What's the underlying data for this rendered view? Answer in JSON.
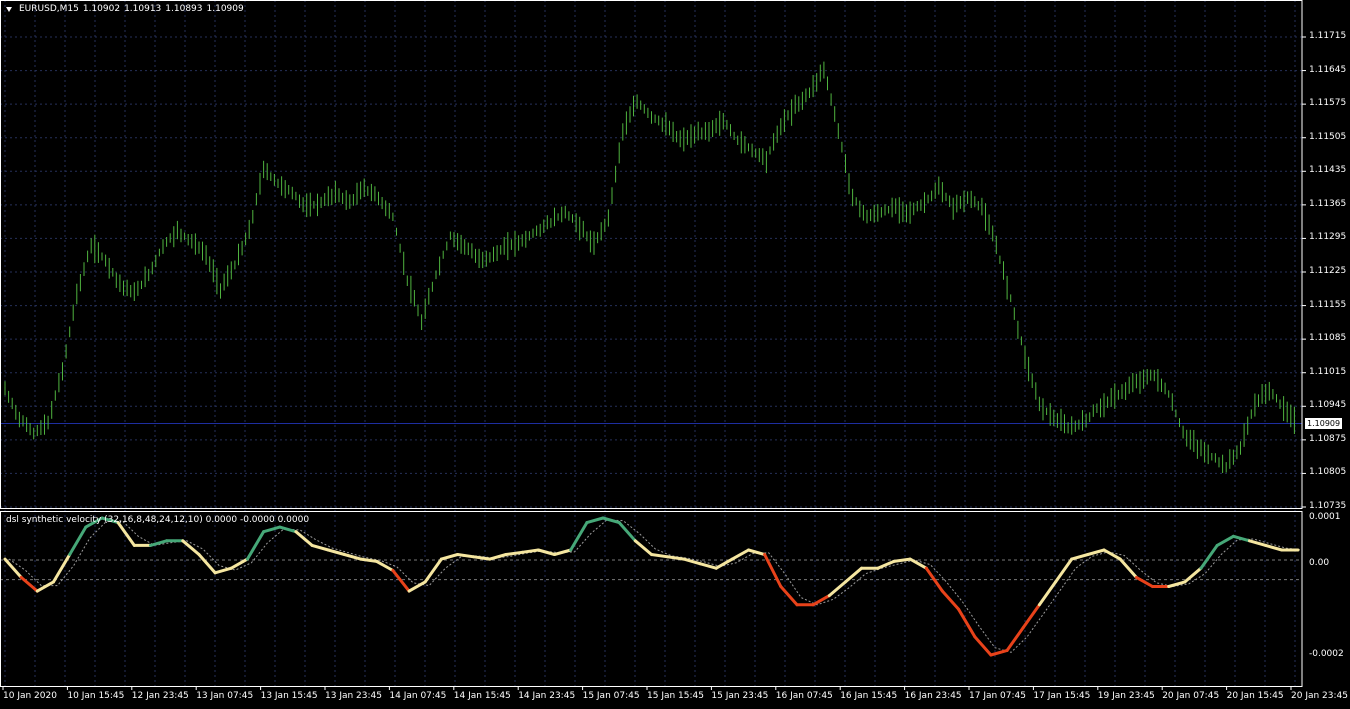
{
  "chart": {
    "symbol_timeframe": "EURUSD,M15",
    "ohlc": [
      "1.10902",
      "1.10913",
      "1.10893",
      "1.10909"
    ],
    "current_price": "1.10909",
    "price_axis": [
      "1.11715",
      "1.11645",
      "1.11575",
      "1.11505",
      "1.11435",
      "1.11365",
      "1.11295",
      "1.11225",
      "1.11155",
      "1.11085",
      "1.11015",
      "1.10945",
      "1.10875",
      "1.10805",
      "1.10735"
    ],
    "indicator_label": "dsl synthetic velocity (32,16,8,48,24,12,10) 0.0000 -0.0000 0.0000",
    "indicator_axis": [
      "0.0001",
      "0.00",
      "-0.0002"
    ],
    "time_axis": [
      "10 Jan 2020",
      "10 Jan 15:45",
      "12 Jan 23:45",
      "13 Jan 07:45",
      "13 Jan 15:45",
      "13 Jan 23:45",
      "14 Jan 07:45",
      "14 Jan 15:45",
      "14 Jan 23:45",
      "15 Jan 07:45",
      "15 Jan 15:45",
      "15 Jan 23:45",
      "16 Jan 07:45",
      "16 Jan 15:45",
      "16 Jan 23:45",
      "17 Jan 07:45",
      "17 Jan 15:45",
      "19 Jan 23:45",
      "20 Jan 07:45",
      "20 Jan 15:45",
      "20 Jan 23:45"
    ],
    "colors": {
      "background": "#000000",
      "grid": "#26305a",
      "bars": "#4fb33f",
      "current_price_line": "#1e2ea0",
      "axis": "#ffffff",
      "velocity_up": "#46a878",
      "velocity_neutral": "#f5e6a0",
      "velocity_down": "#e8421a",
      "levels": "#7a7a7a"
    }
  },
  "chart_data": {
    "type": "line",
    "series": [
      {
        "values": [
          1.1098,
          1.1092,
          1.1089,
          1.1091,
          1.1102,
          1.1118,
          1.1128,
          1.1125,
          1.112,
          1.1118,
          1.1122,
          1.1128,
          1.1131,
          1.1129,
          1.1126,
          1.1119,
          1.1124,
          1.1131,
          1.1144,
          1.1141,
          1.1139,
          1.1136,
          1.1137,
          1.1139,
          1.1137,
          1.114,
          1.1138,
          1.1134,
          1.1121,
          1.1112,
          1.1122,
          1.113,
          1.1128,
          1.1125,
          1.1126,
          1.1128,
          1.1129,
          1.1131,
          1.1133,
          1.1135,
          1.1132,
          1.1128,
          1.1134,
          1.1152,
          1.1158,
          1.1155,
          1.1153,
          1.115,
          1.1151,
          1.1152,
          1.1154,
          1.115,
          1.1148,
          1.1146,
          1.1153,
          1.1157,
          1.116,
          1.1165,
          1.1152,
          1.1138,
          1.1134,
          1.1135,
          1.1136,
          1.1135,
          1.1137,
          1.114,
          1.1136,
          1.1138,
          1.1136,
          1.1128,
          1.1117,
          1.1105,
          1.1095,
          1.1092,
          1.109,
          1.1091,
          1.1094,
          1.1096,
          1.1098,
          1.11,
          1.1101,
          1.1097,
          1.1089,
          1.1086,
          1.1084,
          1.1082,
          1.1086,
          1.1095,
          1.1098,
          1.1094,
          1.1091
        ]
      }
    ],
    "ylim": [
      1.10735,
      1.11715
    ],
    "velocity": [
      1e-05,
      -3e-05,
      -6e-05,
      -4e-05,
      2e-05,
      8e-05,
      0.0001,
      9e-05,
      4e-05,
      4e-05,
      5e-05,
      5e-05,
      2e-05,
      -2e-05,
      -1e-05,
      1e-05,
      7e-05,
      8e-05,
      7e-05,
      4e-05,
      3e-05,
      2e-05,
      1e-05,
      5e-06,
      -1.5e-05,
      -6e-05,
      -4e-05,
      1e-05,
      2e-05,
      1.5e-05,
      1e-05,
      2e-05,
      2.5e-05,
      3e-05,
      2e-05,
      3e-05,
      9e-05,
      0.0001,
      9e-05,
      5e-05,
      2e-05,
      1.5e-05,
      1e-05,
      0,
      -1e-05,
      1e-05,
      3e-05,
      2e-05,
      -5e-05,
      -9e-05,
      -9e-05,
      -7e-05,
      -4e-05,
      -1e-05,
      -1e-05,
      5e-06,
      1e-05,
      -1e-05,
      -6e-05,
      -0.0001,
      -0.00016,
      -0.0002,
      -0.00019,
      -0.00014,
      -9e-05,
      -4e-05,
      1e-05,
      2e-05,
      3e-05,
      1e-05,
      -3e-05,
      -5e-05,
      -5e-05,
      -4e-05,
      -1e-05,
      4e-05,
      6e-05,
      5e-05,
      4e-05,
      3e-05,
      3e-05
    ]
  }
}
